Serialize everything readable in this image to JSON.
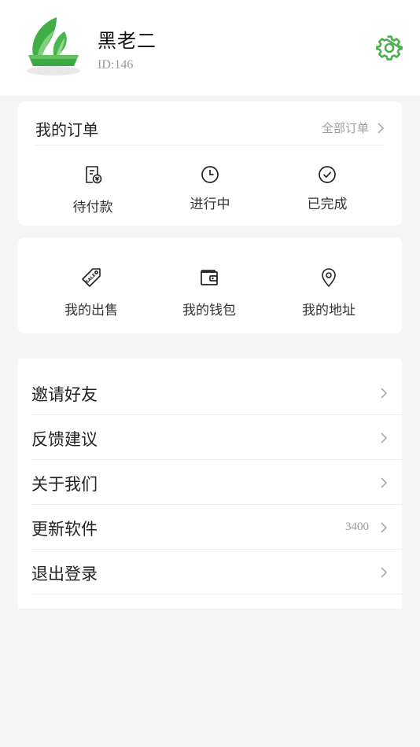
{
  "profile": {
    "name": "黑老二",
    "id_text": "ID:146",
    "brand_color": "#4caf50"
  },
  "orders": {
    "title": "我的订单",
    "all_label": "全部订单",
    "items": [
      {
        "label": "待付款",
        "icon": "pending-payment-icon"
      },
      {
        "label": "进行中",
        "icon": "clock-icon"
      },
      {
        "label": "已完成",
        "icon": "check-circle-icon"
      }
    ]
  },
  "services": {
    "items": [
      {
        "label": "我的出售",
        "icon": "sale-tag-icon"
      },
      {
        "label": "我的钱包",
        "icon": "wallet-icon"
      },
      {
        "label": "我的地址",
        "icon": "location-pin-icon"
      }
    ]
  },
  "menu": {
    "items": [
      {
        "label": "邀请好友",
        "value": ""
      },
      {
        "label": "反馈建议",
        "value": ""
      },
      {
        "label": "关于我们",
        "value": ""
      },
      {
        "label": "更新软件",
        "value": "3400"
      },
      {
        "label": "退出登录",
        "value": ""
      }
    ]
  }
}
